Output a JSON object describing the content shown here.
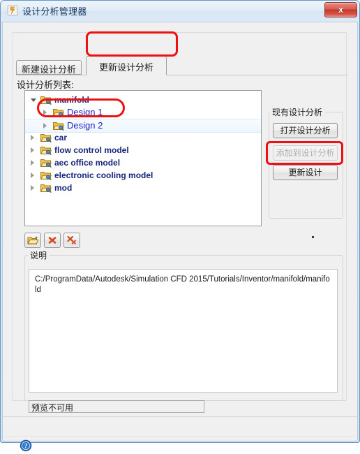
{
  "window": {
    "title": "设计分析管理器",
    "icon": "app-icon",
    "close_label": "x"
  },
  "tabs": [
    {
      "label": "新建设计分析",
      "active": false
    },
    {
      "label": "更新设计分析",
      "active": true
    }
  ],
  "list_label": "设计分析列表:",
  "tree": [
    {
      "label": "manifold",
      "level": 0,
      "expanded": true,
      "selected": false,
      "kind": "root"
    },
    {
      "label": "Design 1",
      "level": 1,
      "expanded": false,
      "selected": false,
      "kind": "design"
    },
    {
      "label": "Design 2",
      "level": 1,
      "expanded": false,
      "selected": true,
      "kind": "design"
    },
    {
      "label": "car",
      "level": 0,
      "expanded": false,
      "selected": false,
      "kind": "root"
    },
    {
      "label": "flow control model",
      "level": 0,
      "expanded": false,
      "selected": false,
      "kind": "root"
    },
    {
      "label": "aec office model",
      "level": 0,
      "expanded": false,
      "selected": false,
      "kind": "root"
    },
    {
      "label": "electronic cooling model",
      "level": 0,
      "expanded": false,
      "selected": false,
      "kind": "root"
    },
    {
      "label": "mod",
      "level": 0,
      "expanded": false,
      "selected": false,
      "kind": "root"
    }
  ],
  "group": {
    "title": "现有设计分析",
    "buttons": [
      {
        "label": "打开设计分析",
        "disabled": false
      },
      {
        "label": "添加到设计分析",
        "disabled": true
      },
      {
        "label": "更新设计",
        "disabled": false
      }
    ]
  },
  "toolbar": [
    {
      "icon": "open-folder-icon"
    },
    {
      "icon": "delete-x-icon"
    },
    {
      "icon": "delete-all-xx-icon"
    }
  ],
  "description": {
    "title": "说明",
    "text": "C:/ProgramData/Autodesk/Simulation CFD 2015/Tutorials/Inventor/manifold/manifold"
  },
  "preview": {
    "text": "预览不可用"
  },
  "footer": {
    "help_icon": "help-question-icon"
  },
  "colors": {
    "accent_red": "#ee1111",
    "root_text": "#16257c",
    "design_text": "#2222cc",
    "title_text": "#13365e",
    "close_red": "#c0392c"
  }
}
